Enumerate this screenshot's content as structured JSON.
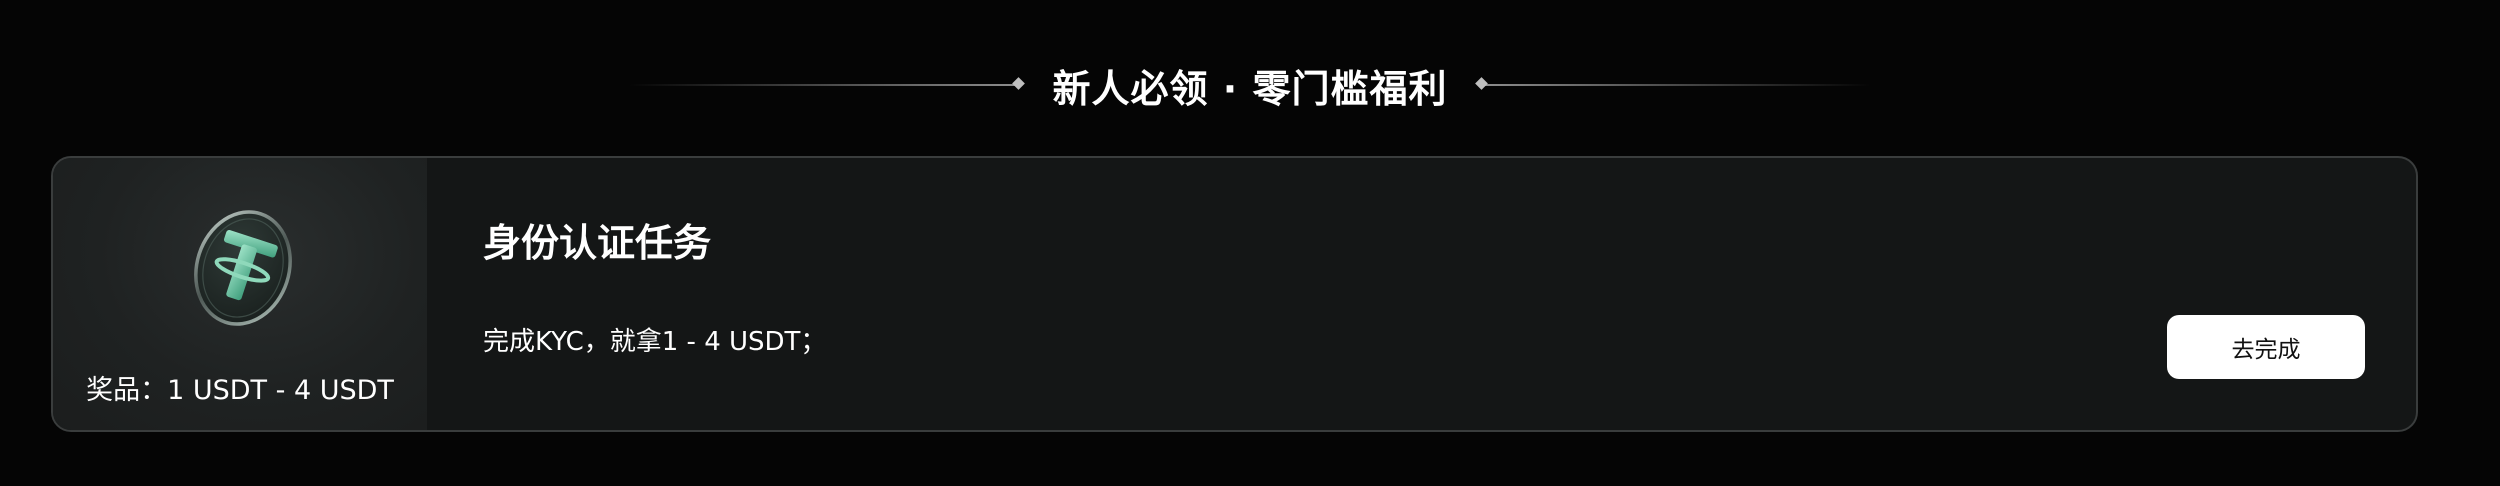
{
  "section": {
    "title": "新人必领 · 零门槛福利"
  },
  "task": {
    "title": "身份认证任务",
    "description": "完成KYC，就拿1 - 4 USDT；",
    "prize_label": "奖品：1 USDT - 4 USDT",
    "prize_icon": "usdt-coin-icon",
    "button_label": "去完成"
  },
  "colors": {
    "background": "#050505",
    "card_background": "#141616",
    "card_border": "#3a3d3d",
    "prize_panel": "#1f2222",
    "coin_accent": "#5fbf9c",
    "button_background": "#ffffff",
    "button_text": "#111111"
  }
}
